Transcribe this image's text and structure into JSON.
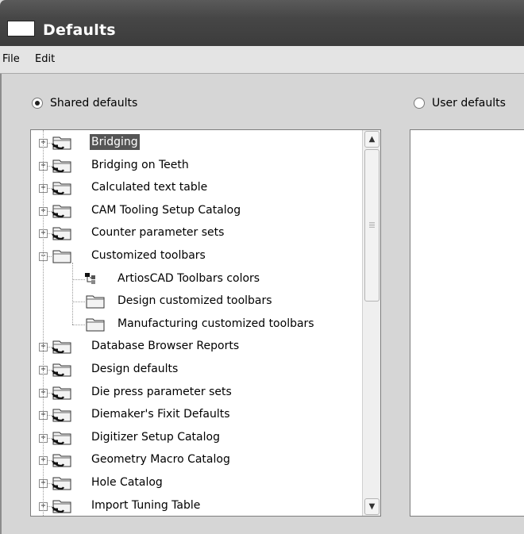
{
  "window": {
    "title": "Defaults"
  },
  "menu": {
    "items": [
      "File",
      "Edit"
    ]
  },
  "options": {
    "shared_label": "Shared defaults",
    "user_label": "User defaults",
    "selected": "shared"
  },
  "tree": {
    "items": [
      {
        "label": "Bridging",
        "icon": "shared-folder-icon",
        "expander": "+",
        "level": 0,
        "selected": true
      },
      {
        "label": "Bridging on Teeth",
        "icon": "shared-folder-icon",
        "expander": "+",
        "level": 0
      },
      {
        "label": "Calculated text table",
        "icon": "shared-folder-icon",
        "expander": "+",
        "level": 0
      },
      {
        "label": "CAM Tooling Setup Catalog",
        "icon": "shared-folder-icon",
        "expander": "+",
        "level": 0
      },
      {
        "label": "Counter parameter sets",
        "icon": "shared-folder-icon",
        "expander": "+",
        "level": 0
      },
      {
        "label": "Customized toolbars",
        "icon": "folder-icon",
        "expander": "-",
        "level": 0
      },
      {
        "label": "ArtiosCAD Toolbars colors",
        "icon": "settings-item-icon",
        "expander": "",
        "level": 1
      },
      {
        "label": "Design customized toolbars",
        "icon": "folder-icon",
        "expander": "",
        "level": 1
      },
      {
        "label": "Manufacturing customized toolbars",
        "icon": "folder-icon",
        "expander": "",
        "level": 1
      },
      {
        "label": "Database Browser Reports",
        "icon": "shared-folder-icon",
        "expander": "+",
        "level": 0
      },
      {
        "label": "Design defaults",
        "icon": "shared-folder-icon",
        "expander": "+",
        "level": 0
      },
      {
        "label": "Die press parameter sets",
        "icon": "shared-folder-icon",
        "expander": "+",
        "level": 0
      },
      {
        "label": "Diemaker's Fixit Defaults",
        "icon": "shared-folder-icon",
        "expander": "+",
        "level": 0
      },
      {
        "label": "Digitizer Setup Catalog",
        "icon": "shared-folder-icon",
        "expander": "+",
        "level": 0
      },
      {
        "label": "Geometry Macro Catalog",
        "icon": "shared-folder-icon",
        "expander": "+",
        "level": 0
      },
      {
        "label": "Hole Catalog",
        "icon": "shared-folder-icon",
        "expander": "+",
        "level": 0
      },
      {
        "label": "Import Tuning Table",
        "icon": "shared-folder-icon",
        "expander": "+",
        "level": 0
      }
    ]
  },
  "scrollbar": {
    "up": "▲",
    "down": "▼"
  }
}
